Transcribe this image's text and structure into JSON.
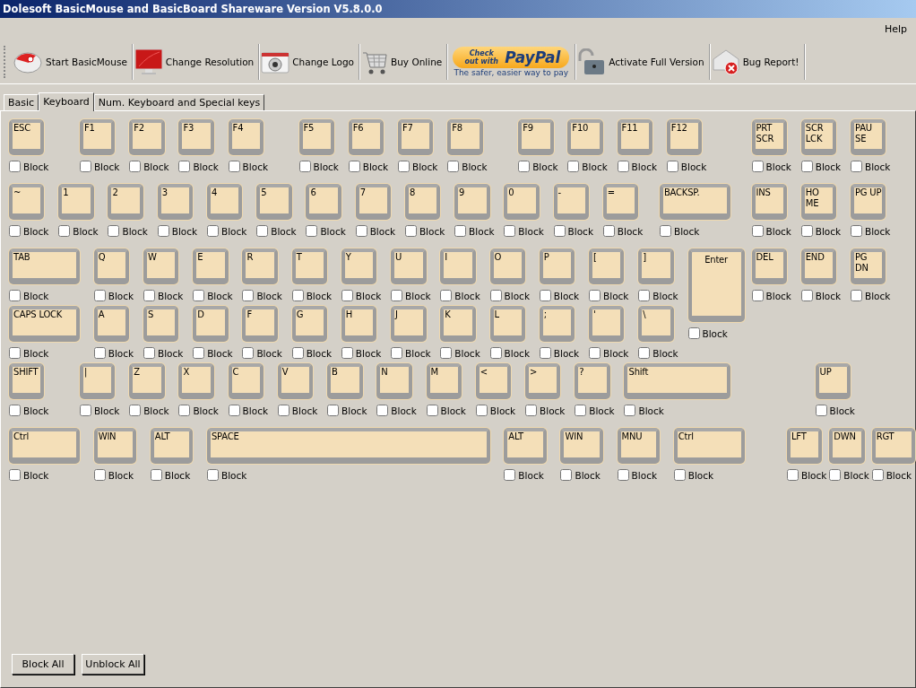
{
  "window": {
    "title": "Dolesoft BasicMouse and BasicBoard Shareware Version V5.8.0.0"
  },
  "menu": [
    "Help"
  ],
  "toolbar": [
    {
      "kind": "mouse",
      "label": "Start BasicMouse"
    },
    {
      "kind": "monitor",
      "label": "Change Resolution"
    },
    {
      "kind": "camera",
      "label": "Change Logo"
    },
    {
      "kind": "cart",
      "label": "Buy Online"
    },
    {
      "kind": "paypal",
      "label": "Check out with",
      "brand": "PayPal",
      "caption": "The safer, easier way to pay"
    },
    {
      "kind": "lock",
      "label": "Activate Full Version"
    },
    {
      "kind": "bug",
      "label": "Bug Report!"
    }
  ],
  "tabs": [
    {
      "label": "Basic",
      "selected": false
    },
    {
      "label": "Keyboard",
      "selected": true
    },
    {
      "label": "Num. Keyboard and Special keys",
      "selected": false
    }
  ],
  "keyboard": {
    "rows": [
      {
        "keys": [
          {
            "label": "ESC",
            "block_label": "Block",
            "blocked": false
          },
          {
            "label": "F1",
            "block_label": "Block",
            "blocked": false
          },
          {
            "label": "F2",
            "block_label": "Block",
            "blocked": false
          },
          {
            "label": "F3",
            "block_label": "Block",
            "blocked": false
          },
          {
            "label": "F4",
            "block_label": "Block",
            "blocked": false
          },
          {
            "label": "F5",
            "block_label": "Block",
            "blocked": false
          },
          {
            "label": "F6",
            "block_label": "Block",
            "blocked": false
          },
          {
            "label": "F7",
            "block_label": "Block",
            "blocked": false
          },
          {
            "label": "F8",
            "block_label": "Block",
            "blocked": false
          },
          {
            "label": "F9",
            "block_label": "Block",
            "blocked": false
          },
          {
            "label": "F10",
            "block_label": "Block",
            "blocked": false
          },
          {
            "label": "F11",
            "block_label": "Block",
            "blocked": false
          },
          {
            "label": "F12",
            "block_label": "Block",
            "blocked": false
          },
          {
            "label": "PRT SCR",
            "block_label": "Block",
            "blocked": false
          },
          {
            "label": "SCR LCK",
            "block_label": "Block",
            "blocked": false
          },
          {
            "label": "PAU SE",
            "block_label": "Block",
            "blocked": false
          }
        ]
      },
      {
        "keys": [
          {
            "label": "~",
            "block_label": "Block",
            "blocked": false
          },
          {
            "label": "1",
            "block_label": "Block",
            "blocked": false
          },
          {
            "label": "2",
            "block_label": "Block",
            "blocked": false
          },
          {
            "label": "3",
            "block_label": "Block",
            "blocked": false
          },
          {
            "label": "4",
            "block_label": "Block",
            "blocked": false
          },
          {
            "label": "5",
            "block_label": "Block",
            "blocked": false
          },
          {
            "label": "6",
            "block_label": "Block",
            "blocked": false
          },
          {
            "label": "7",
            "block_label": "Block",
            "blocked": false
          },
          {
            "label": "8",
            "block_label": "Block",
            "blocked": false
          },
          {
            "label": "9",
            "block_label": "Block",
            "blocked": false
          },
          {
            "label": "0",
            "block_label": "Block",
            "blocked": false
          },
          {
            "label": "-",
            "block_label": "Block",
            "blocked": false
          },
          {
            "label": "=",
            "block_label": "Block",
            "blocked": false
          },
          {
            "label": "BACKSP.",
            "block_label": "Block",
            "blocked": false
          },
          {
            "label": "INS",
            "block_label": "Block",
            "blocked": false
          },
          {
            "label": "HO ME",
            "block_label": "Block",
            "blocked": false
          },
          {
            "label": "PG UP",
            "block_label": "Block",
            "blocked": false
          }
        ]
      },
      {
        "keys": [
          {
            "label": "TAB",
            "block_label": "Block",
            "blocked": false
          },
          {
            "label": "Q",
            "block_label": "Block",
            "blocked": false
          },
          {
            "label": "W",
            "block_label": "Block",
            "blocked": false
          },
          {
            "label": "E",
            "block_label": "Block",
            "blocked": false
          },
          {
            "label": "R",
            "block_label": "Block",
            "blocked": false
          },
          {
            "label": "T",
            "block_label": "Block",
            "blocked": false
          },
          {
            "label": "Y",
            "block_label": "Block",
            "blocked": false
          },
          {
            "label": "U",
            "block_label": "Block",
            "blocked": false
          },
          {
            "label": "I",
            "block_label": "Block",
            "blocked": false
          },
          {
            "label": "O",
            "block_label": "Block",
            "blocked": false
          },
          {
            "label": "P",
            "block_label": "Block",
            "blocked": false
          },
          {
            "label": "[",
            "block_label": "Block",
            "blocked": false
          },
          {
            "label": "]",
            "block_label": "Block",
            "blocked": false
          },
          {
            "label": "Enter",
            "block_label": "Block",
            "blocked": false
          },
          {
            "label": "DEL",
            "block_label": "Block",
            "blocked": false
          },
          {
            "label": "END",
            "block_label": "Block",
            "blocked": false
          },
          {
            "label": "PG DN",
            "block_label": "Block",
            "blocked": false
          }
        ]
      },
      {
        "keys": [
          {
            "label": "CAPS LOCK",
            "block_label": "Block",
            "blocked": false
          },
          {
            "label": "A",
            "block_label": "Block",
            "blocked": false
          },
          {
            "label": "S",
            "block_label": "Block",
            "blocked": false
          },
          {
            "label": "D",
            "block_label": "Block",
            "blocked": false
          },
          {
            "label": "F",
            "block_label": "Block",
            "blocked": false
          },
          {
            "label": "G",
            "block_label": "Block",
            "blocked": false
          },
          {
            "label": "H",
            "block_label": "Block",
            "blocked": false
          },
          {
            "label": "J",
            "block_label": "Block",
            "blocked": false
          },
          {
            "label": "K",
            "block_label": "Block",
            "blocked": false
          },
          {
            "label": "L",
            "block_label": "Block",
            "blocked": false
          },
          {
            "label": ";",
            "block_label": "Block",
            "blocked": false
          },
          {
            "label": "'",
            "block_label": "Block",
            "blocked": false
          },
          {
            "label": "\\",
            "block_label": "Block",
            "blocked": false
          }
        ]
      },
      {
        "keys": [
          {
            "label": "SHIFT",
            "block_label": "Block",
            "blocked": false
          },
          {
            "label": "|",
            "block_label": "Block",
            "blocked": false
          },
          {
            "label": "Z",
            "block_label": "Block",
            "blocked": false
          },
          {
            "label": "X",
            "block_label": "Block",
            "blocked": false
          },
          {
            "label": "C",
            "block_label": "Block",
            "blocked": false
          },
          {
            "label": "V",
            "block_label": "Block",
            "blocked": false
          },
          {
            "label": "B",
            "block_label": "Block",
            "blocked": false
          },
          {
            "label": "N",
            "block_label": "Block",
            "blocked": false
          },
          {
            "label": "M",
            "block_label": "Block",
            "blocked": false
          },
          {
            "label": "<",
            "block_label": "Block",
            "blocked": false
          },
          {
            "label": ">",
            "block_label": "Block",
            "blocked": false
          },
          {
            "label": "?",
            "block_label": "Block",
            "blocked": false
          },
          {
            "label": "Shift",
            "block_label": "Block",
            "blocked": false
          },
          {
            "label": "UP",
            "block_label": "Block",
            "blocked": false
          }
        ]
      },
      {
        "keys": [
          {
            "label": "Ctrl",
            "block_label": "Block",
            "blocked": false
          },
          {
            "label": "WIN",
            "block_label": "Block",
            "blocked": false
          },
          {
            "label": "ALT",
            "block_label": "Block",
            "blocked": false
          },
          {
            "label": "SPACE",
            "block_label": "Block",
            "blocked": false
          },
          {
            "label": "ALT",
            "block_label": "Block",
            "blocked": false
          },
          {
            "label": "WIN",
            "block_label": "Block",
            "blocked": false
          },
          {
            "label": "MNU",
            "block_label": "Block",
            "blocked": false
          },
          {
            "label": "Ctrl",
            "block_label": "Block",
            "blocked": false
          },
          {
            "label": "LFT",
            "block_label": "Block",
            "blocked": false
          },
          {
            "label": "DWN",
            "block_label": "Block",
            "blocked": false
          },
          {
            "label": "RGT",
            "block_label": "Block",
            "blocked": false
          }
        ]
      }
    ]
  },
  "buttons": [
    "Block All",
    "Unblock All"
  ]
}
